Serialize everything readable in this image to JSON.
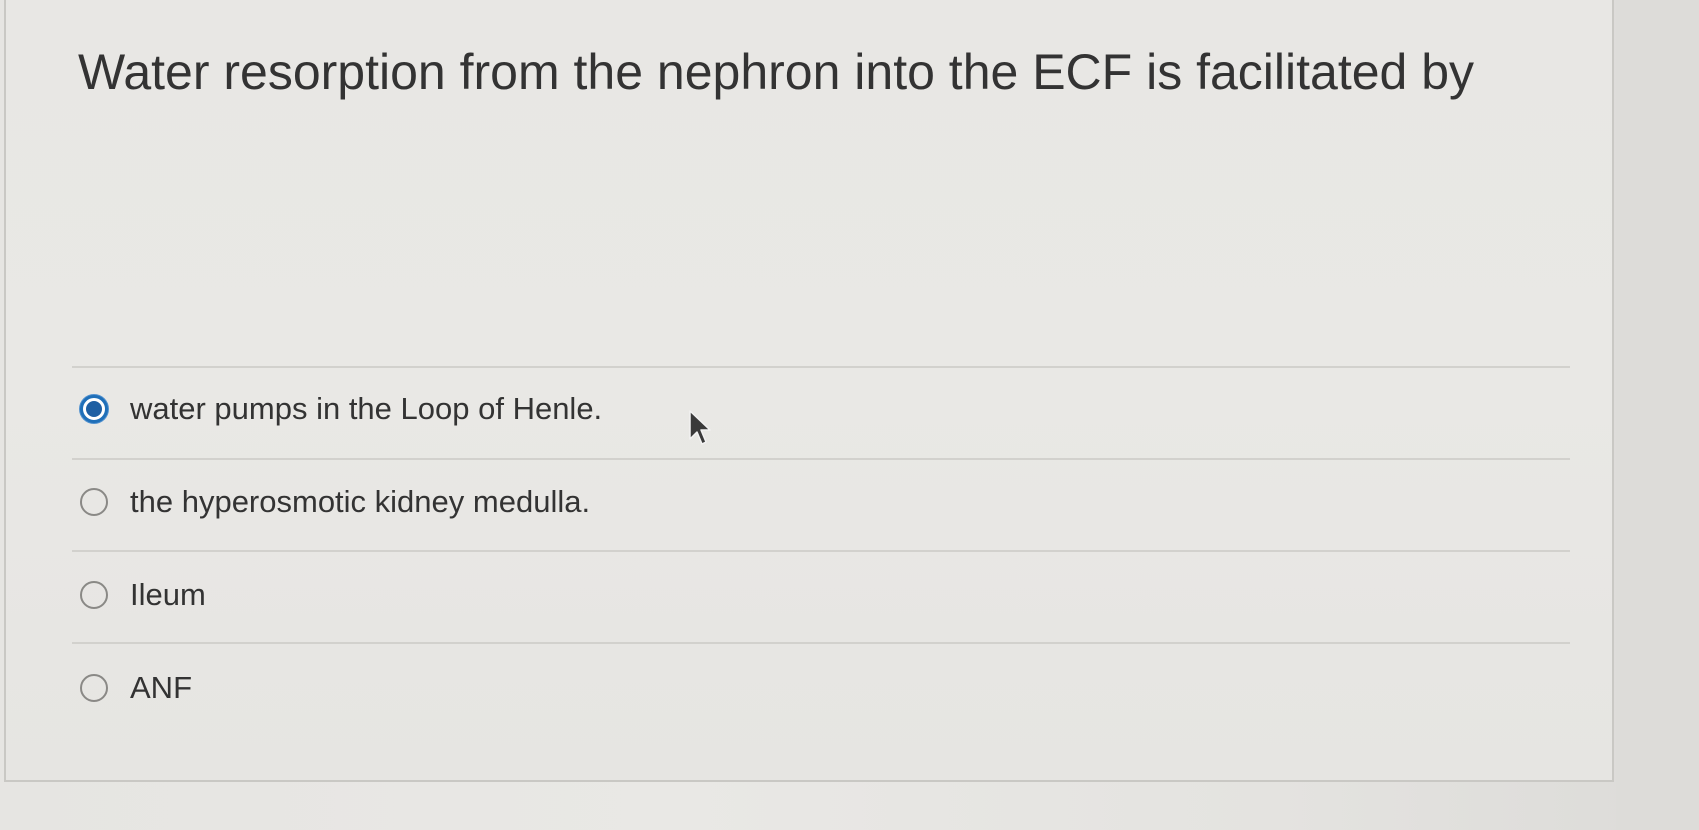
{
  "question": {
    "text": "Water resorption from the nephron into the ECF is facilitated by"
  },
  "options": [
    {
      "label": "water pumps in the Loop of Henle.",
      "selected": true
    },
    {
      "label": "the hyperosmotic kidney medulla.",
      "selected": false
    },
    {
      "label": "Ileum",
      "selected": false
    },
    {
      "label": "ANF",
      "selected": false
    }
  ],
  "colors": {
    "selected_radio": "#1e5fa3",
    "text": "#333333",
    "background": "#e8e7e4"
  },
  "icons": {
    "cursor": "mouse-pointer-icon",
    "radio_selected": "radio-selected-icon",
    "radio_unselected": "radio-unselected-icon"
  }
}
